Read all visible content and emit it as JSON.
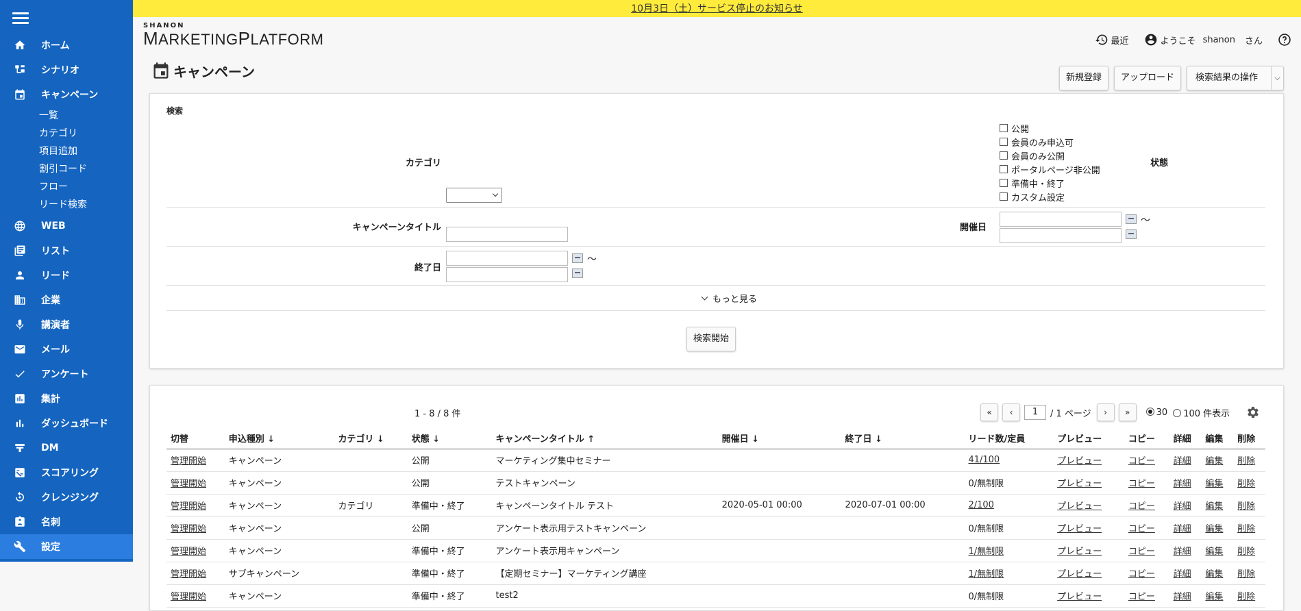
{
  "notice": {
    "text": "10月3日（土）サービス停止のお知らせ"
  },
  "logo": {
    "small": "SHANON",
    "big_m": "M",
    "big_rest1": "ARKETING",
    "big_p": "P",
    "big_rest2": "LATFORM"
  },
  "header": {
    "recent": "最近",
    "welcome": "ようこそ",
    "user": "shanon",
    "suffix": "さん"
  },
  "sidebar": {
    "items": [
      {
        "label": "ホーム",
        "icon": "home-icon"
      },
      {
        "label": "シナリオ",
        "icon": "scenario-icon"
      },
      {
        "label": "キャンペーン",
        "icon": "calendar-icon"
      },
      {
        "label": "WEB",
        "icon": "globe-icon"
      },
      {
        "label": "リスト",
        "icon": "list-icon"
      },
      {
        "label": "リード",
        "icon": "person-icon"
      },
      {
        "label": "企業",
        "icon": "building-icon"
      },
      {
        "label": "講演者",
        "icon": "mic-icon"
      },
      {
        "label": "メール",
        "icon": "mail-icon"
      },
      {
        "label": "アンケート",
        "icon": "check-icon"
      },
      {
        "label": "集計",
        "icon": "report-icon"
      },
      {
        "label": "ダッシュボード",
        "icon": "bar-chart-icon"
      },
      {
        "label": "DM",
        "icon": "dm-icon"
      },
      {
        "label": "スコアリング",
        "icon": "scoring-icon"
      },
      {
        "label": "クレンジング",
        "icon": "cleansing-icon"
      },
      {
        "label": "名刺",
        "icon": "card-icon"
      },
      {
        "label": "設定",
        "icon": "wrench-icon"
      }
    ],
    "sub_items": [
      "一覧",
      "カテゴリ",
      "項目追加",
      "割引コード",
      "フロー",
      "リード検索"
    ]
  },
  "page": {
    "title": "キャンペーン"
  },
  "toolbar": {
    "new": "新規登録",
    "upload": "アップロード",
    "ops": "検索結果の操作"
  },
  "search": {
    "title": "検索",
    "category_label": "カテゴリ",
    "status_label": "状態",
    "statuses": [
      "公開",
      "会員のみ申込可",
      "会員のみ公開",
      "ポータルページ非公開",
      "準備中・終了",
      "カスタム設定"
    ],
    "campaign_title_label": "キャンペーンタイトル",
    "start_label": "開催日",
    "end_label": "終了日",
    "tilde": "～",
    "more": "もっと見る",
    "submit": "検索開始"
  },
  "results": {
    "count": "1 - 8 / 8 件",
    "page_value": "1",
    "page_total": "/ 1 ページ",
    "per_30": "30",
    "per_100": "100 件表示",
    "pager": {
      "first": "«",
      "prev": "‹",
      "next": "›",
      "last": "»"
    },
    "headers": [
      "切替",
      "申込種別 ↓",
      "カテゴリ ↓",
      "状態 ↓",
      "キャンペーンタイトル ↑",
      "開催日 ↓",
      "終了日 ↓",
      "リード数/定員",
      "プレビュー",
      "コピー",
      "詳細",
      "編集",
      "削除"
    ],
    "rows": [
      {
        "toggle": "管理開始",
        "type": "キャンペーン",
        "category": "",
        "status": "公開",
        "title": "マーケティング集中セミナー",
        "start": "",
        "end": "",
        "leads": "41/100",
        "leads_link": true,
        "preview": "プレビュー",
        "copy": "コピー",
        "detail": "詳細",
        "edit": "編集",
        "delete": "削除"
      },
      {
        "toggle": "管理開始",
        "type": "キャンペーン",
        "category": "",
        "status": "公開",
        "title": "テストキャンペーン",
        "start": "",
        "end": "",
        "leads": "0/無制限",
        "leads_link": false,
        "preview": "プレビュー",
        "copy": "コピー",
        "detail": "詳細",
        "edit": "編集",
        "delete": "削除"
      },
      {
        "toggle": "管理開始",
        "type": "キャンペーン",
        "category": "カテゴリ",
        "status": "準備中・終了",
        "title": "キャンペーンタイトル テスト",
        "start": "2020-05-01 00:00",
        "end": "2020-07-01 00:00",
        "leads": "2/100",
        "leads_link": true,
        "preview": "プレビュー",
        "copy": "コピー",
        "detail": "詳細",
        "edit": "編集",
        "delete": "削除"
      },
      {
        "toggle": "管理開始",
        "type": "キャンペーン",
        "category": "",
        "status": "公開",
        "title": "アンケート表示用テストキャンペーン",
        "start": "",
        "end": "",
        "leads": "0/無制限",
        "leads_link": false,
        "preview": "プレビュー",
        "copy": "コピー",
        "detail": "詳細",
        "edit": "編集",
        "delete": "削除"
      },
      {
        "toggle": "管理開始",
        "type": "キャンペーン",
        "category": "",
        "status": "準備中・終了",
        "title": "アンケート表示用キャンペーン",
        "start": "",
        "end": "",
        "leads": "1/無制限",
        "leads_link": true,
        "preview": "プレビュー",
        "copy": "コピー",
        "detail": "詳細",
        "edit": "編集",
        "delete": "削除"
      },
      {
        "toggle": "管理開始",
        "type": "サブキャンペーン",
        "category": "",
        "status": "準備中・終了",
        "title": "【定期セミナー】マーケティング講座",
        "start": "",
        "end": "",
        "leads": "1/無制限",
        "leads_link": true,
        "preview": "プレビュー",
        "copy": "コピー",
        "detail": "詳細",
        "edit": "編集",
        "delete": "削除"
      },
      {
        "toggle": "管理開始",
        "type": "キャンペーン",
        "category": "",
        "status": "準備中・終了",
        "title": "test2",
        "start": "",
        "end": "",
        "leads": "0/無制限",
        "leads_link": false,
        "preview": "プレビュー",
        "copy": "コピー",
        "detail": "詳細",
        "edit": "編集",
        "delete": "削除"
      }
    ]
  }
}
